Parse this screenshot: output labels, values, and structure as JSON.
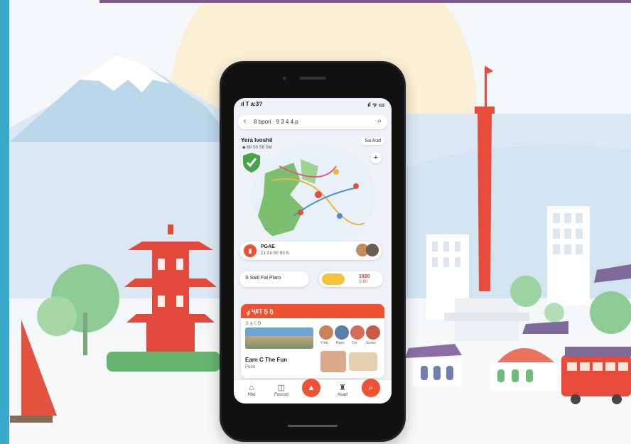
{
  "status_bar": {
    "time": "ıl T a:3?",
    "right_icons": "ıl ᯤ ▭"
  },
  "search": {
    "back_icon": "chevron-left-icon",
    "query": "8 bpori · 9 3 4 4 p",
    "search_icon": "search-icon"
  },
  "place": {
    "title": "Yera Ivoshil",
    "subtitle": "◆ 68 S0 S6 SM",
    "add_label": "Sa Aud",
    "plus_label": "+"
  },
  "map_pin_card": {
    "title": "PGAE",
    "subtitle": "Σ1 Σ8 S0 S0 S"
  },
  "action_row": {
    "left_label": "S Saiti Fal Plaro",
    "right_label": "1920",
    "right_sub": "S 60"
  },
  "feature_card": {
    "header": "ݷ ҶϐҬ Ҕ Ҕ",
    "place_caption": "ℬ ℈ ℰ ⅁",
    "thumb_captions": [
      "Ymb",
      "Raes",
      "Tm",
      "Sooks"
    ],
    "item_title": "Earn C The Fun",
    "item_sub": "Pooo"
  },
  "tabs": [
    {
      "label": "Hhd",
      "icon": "home-icon"
    },
    {
      "label": "Foscod",
      "icon": "map-icon"
    },
    {
      "label": "",
      "icon": "compass-icon"
    },
    {
      "label": "Asad",
      "icon": "castle-icon"
    },
    {
      "label": "",
      "icon": "search-icon"
    }
  ],
  "colors": {
    "accent": "#ee5131",
    "sky": "#e2edf5",
    "tower": "#e84a3b",
    "green": "#7fc48c",
    "map_land": "#7cc06f"
  }
}
